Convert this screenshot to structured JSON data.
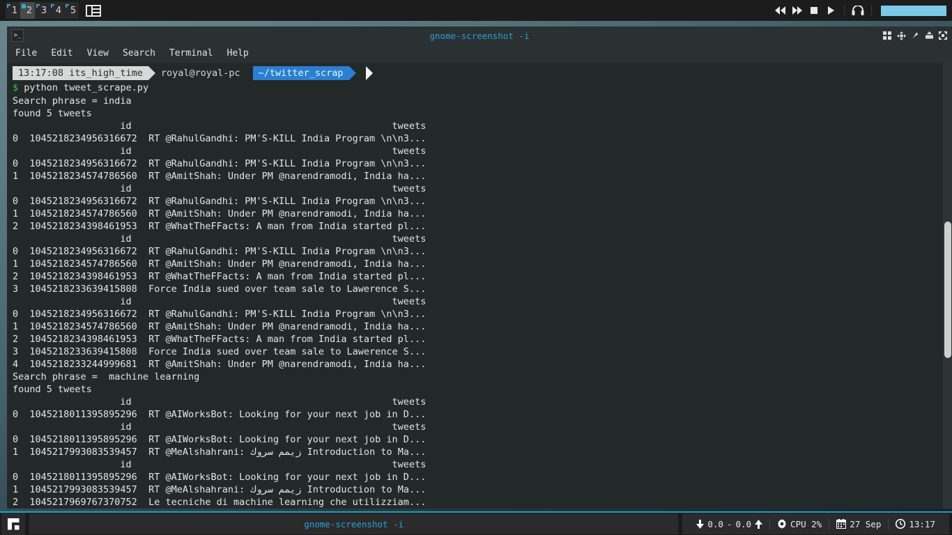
{
  "top_panel": {
    "workspaces": [
      {
        "num": "1",
        "active": false
      },
      {
        "num": "2",
        "active": true
      },
      {
        "num": "3",
        "active": false
      },
      {
        "num": "4",
        "active": false
      },
      {
        "num": "5",
        "active": false
      }
    ],
    "layout_icon": "tiling-layout-icon",
    "media_controls": [
      {
        "name": "rewind-button",
        "glyph": "◀◀"
      },
      {
        "name": "fast-forward-button",
        "glyph": "▶▶"
      },
      {
        "name": "stop-button",
        "glyph": "■"
      },
      {
        "name": "play-button",
        "glyph": "▶"
      }
    ],
    "headphone_icon": "headphone-icon",
    "volume_color": "#7bc8e8"
  },
  "window": {
    "title": "gnome-screenshot -i",
    "title_color": "#2b9fd4",
    "icon": "terminal-icon",
    "icon_glyph": ">_",
    "controls": [
      {
        "name": "tile-windows-button",
        "glyph": "◰"
      },
      {
        "name": "move-window-button",
        "glyph": "✥"
      },
      {
        "name": "pin-window-button",
        "glyph": "✒"
      },
      {
        "name": "shade-window-button",
        "glyph": "⤒"
      },
      {
        "name": "maximize-window-button",
        "glyph": "⤡⤢"
      }
    ],
    "menus": [
      "File",
      "Edit",
      "View",
      "Search",
      "Terminal",
      "Help"
    ]
  },
  "prompt": {
    "time": "13:17:08",
    "session": "its_high_time",
    "user_host": "royal@royal-pc",
    "path": "~/twitter_scrap",
    "dollar": "$",
    "command": "python tweet_scrape.py"
  },
  "terminal_lines": [
    "Search phrase = india",
    "found 5 tweets",
    "                   id                                              tweets",
    "0  1045218234956316672  RT @RahulGandhi: PM'S-KILL India Program \\n\\n3...",
    "                   id                                              tweets",
    "0  1045218234956316672  RT @RahulGandhi: PM'S-KILL India Program \\n\\n3...",
    "1  1045218234574786560  RT @AmitShah: Under PM @narendramodi, India ha...",
    "                   id                                              tweets",
    "0  1045218234956316672  RT @RahulGandhi: PM'S-KILL India Program \\n\\n3...",
    "1  1045218234574786560  RT @AmitShah: Under PM @narendramodi, India ha...",
    "2  1045218234398461953  RT @WhatTheFFacts: A man from India started pl...",
    "                   id                                              tweets",
    "0  1045218234956316672  RT @RahulGandhi: PM'S-KILL India Program \\n\\n3...",
    "1  1045218234574786560  RT @AmitShah: Under PM @narendramodi, India ha...",
    "2  1045218234398461953  RT @WhatTheFFacts: A man from India started pl...",
    "3  1045218233639415808  Force India sued over team sale to Lawerence S...",
    "                   id                                              tweets",
    "0  1045218234956316672  RT @RahulGandhi: PM'S-KILL India Program \\n\\n3...",
    "1  1045218234574786560  RT @AmitShah: Under PM @narendramodi, India ha...",
    "2  1045218234398461953  RT @WhatTheFFacts: A man from India started pl...",
    "3  1045218233639415808  Force India sued over team sale to Lawerence S...",
    "4  1045218233244999681  RT @AmitShah: Under PM @narendramodi, India ha...",
    "Search phrase =  machine learning",
    "found 5 tweets",
    "                   id                                              tweets",
    "0  1045218011395895296  RT @AIWorksBot: Looking for your next job in D...",
    "                   id                                              tweets",
    "0  1045218011395895296  RT @AIWorksBot: Looking for your next job in D...",
    "1  1045217993083539457  RT @MeAlshahrani: زيمم سروك Introduction to Ma...",
    "                   id                                              tweets",
    "0  1045218011395895296  RT @AIWorksBot: Looking for your next job in D...",
    "1  1045217993083539457  RT @MeAlshahrani: زيمم سروك Introduction to Ma...",
    "2  1045217969767370752  Le tecniche di machine learning che utilizziam..."
  ],
  "taskbar": {
    "launcher_icon": "app-launcher-icon",
    "task_title": "gnome-screenshot -i",
    "task_title_color": "#2b9fd4",
    "status": {
      "network_down_icon": "download-arrow-icon",
      "network_down": "0.0",
      "network_dash": "-",
      "network_up": "0.0",
      "network_up_icon": "upload-arrow-icon",
      "cpu_icon": "gear-icon",
      "cpu_label": "CPU 2%",
      "calendar_icon": "calendar-icon",
      "date": "27 Sep",
      "clock_icon": "clock-icon",
      "time": "13:17"
    }
  }
}
